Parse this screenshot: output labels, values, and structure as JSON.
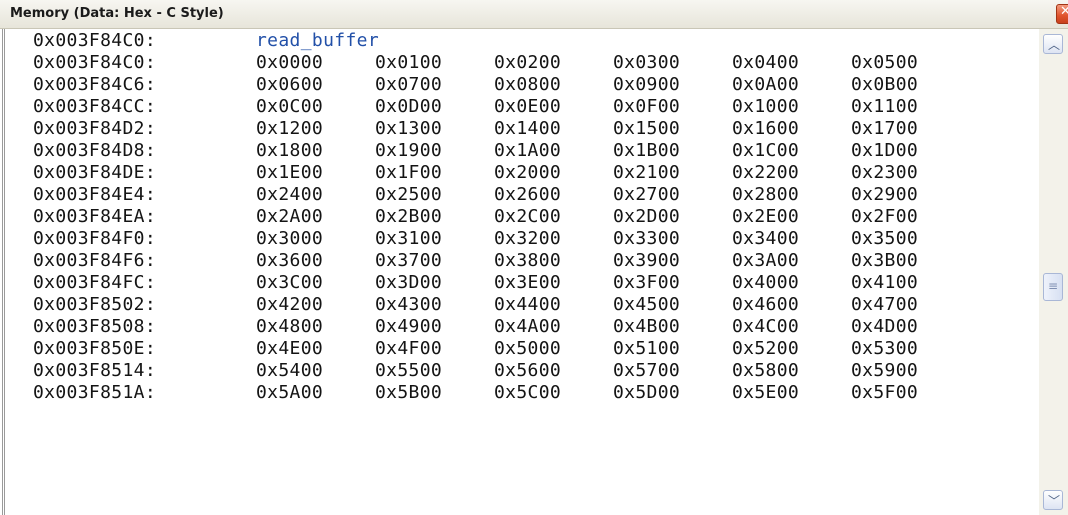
{
  "window": {
    "title": "Memory (Data: Hex - C Style)",
    "close_glyph": "✕"
  },
  "memory": {
    "label_row": {
      "address": "0x003F84C0:",
      "symbol": "read_buffer"
    },
    "rows": [
      {
        "address": "0x003F84C0:",
        "values": [
          "0x0000",
          "0x0100",
          "0x0200",
          "0x0300",
          "0x0400",
          "0x0500"
        ]
      },
      {
        "address": "0x003F84C6:",
        "values": [
          "0x0600",
          "0x0700",
          "0x0800",
          "0x0900",
          "0x0A00",
          "0x0B00"
        ]
      },
      {
        "address": "0x003F84CC:",
        "values": [
          "0x0C00",
          "0x0D00",
          "0x0E00",
          "0x0F00",
          "0x1000",
          "0x1100"
        ]
      },
      {
        "address": "0x003F84D2:",
        "values": [
          "0x1200",
          "0x1300",
          "0x1400",
          "0x1500",
          "0x1600",
          "0x1700"
        ]
      },
      {
        "address": "0x003F84D8:",
        "values": [
          "0x1800",
          "0x1900",
          "0x1A00",
          "0x1B00",
          "0x1C00",
          "0x1D00"
        ]
      },
      {
        "address": "0x003F84DE:",
        "values": [
          "0x1E00",
          "0x1F00",
          "0x2000",
          "0x2100",
          "0x2200",
          "0x2300"
        ]
      },
      {
        "address": "0x003F84E4:",
        "values": [
          "0x2400",
          "0x2500",
          "0x2600",
          "0x2700",
          "0x2800",
          "0x2900"
        ]
      },
      {
        "address": "0x003F84EA:",
        "values": [
          "0x2A00",
          "0x2B00",
          "0x2C00",
          "0x2D00",
          "0x2E00",
          "0x2F00"
        ]
      },
      {
        "address": "0x003F84F0:",
        "values": [
          "0x3000",
          "0x3100",
          "0x3200",
          "0x3300",
          "0x3400",
          "0x3500"
        ]
      },
      {
        "address": "0x003F84F6:",
        "values": [
          "0x3600",
          "0x3700",
          "0x3800",
          "0x3900",
          "0x3A00",
          "0x3B00"
        ]
      },
      {
        "address": "0x003F84FC:",
        "values": [
          "0x3C00",
          "0x3D00",
          "0x3E00",
          "0x3F00",
          "0x4000",
          "0x4100"
        ]
      },
      {
        "address": "0x003F8502:",
        "values": [
          "0x4200",
          "0x4300",
          "0x4400",
          "0x4500",
          "0x4600",
          "0x4700"
        ]
      },
      {
        "address": "0x003F8508:",
        "values": [
          "0x4800",
          "0x4900",
          "0x4A00",
          "0x4B00",
          "0x4C00",
          "0x4D00"
        ]
      },
      {
        "address": "0x003F850E:",
        "values": [
          "0x4E00",
          "0x4F00",
          "0x5000",
          "0x5100",
          "0x5200",
          "0x5300"
        ]
      },
      {
        "address": "0x003F8514:",
        "values": [
          "0x5400",
          "0x5500",
          "0x5600",
          "0x5700",
          "0x5800",
          "0x5900"
        ]
      },
      {
        "address": "0x003F851A:",
        "values": [
          "0x5A00",
          "0x5B00",
          "0x5C00",
          "0x5D00",
          "0x5E00",
          "0x5F00"
        ]
      }
    ]
  },
  "scrollbar": {
    "up_glyph": "︿",
    "down_glyph": "﹀",
    "thumb_glyph": "≡"
  },
  "colors": {
    "symbol_label": "#2250a8",
    "text": "#141414",
    "close_button": "#e0532c"
  }
}
